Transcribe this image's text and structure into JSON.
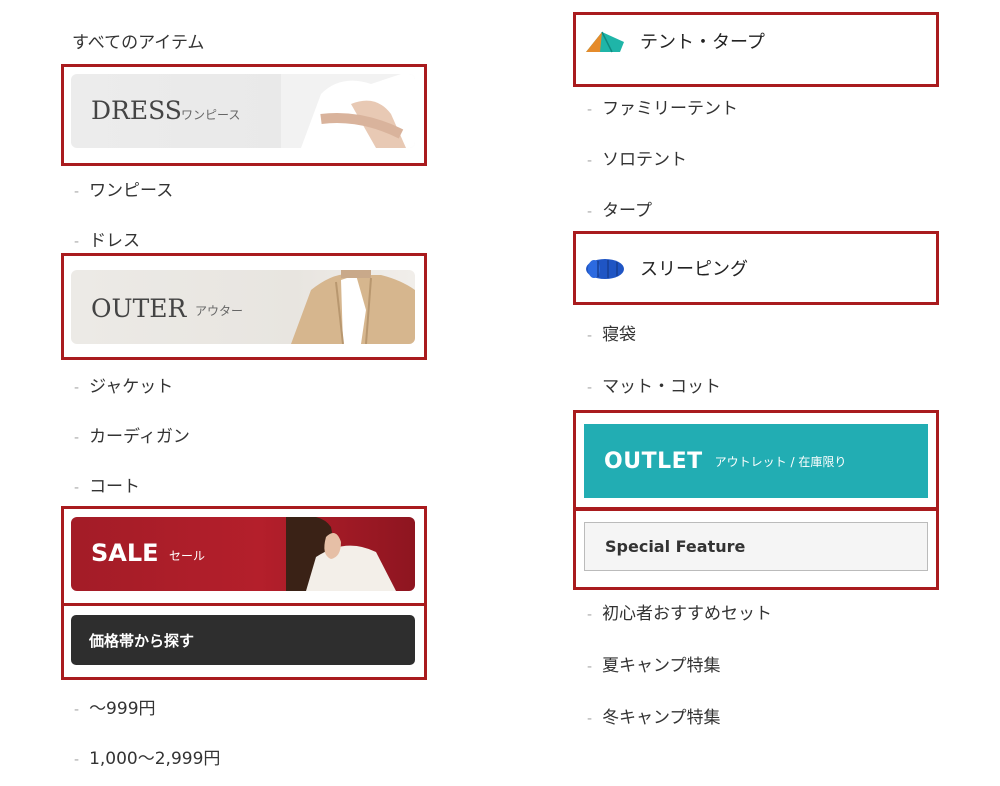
{
  "left": {
    "all_items": "すべてのアイテム",
    "dress": {
      "en": "DRESS",
      "jp": "ワンピース",
      "items": [
        "ワンピース",
        "ドレス"
      ]
    },
    "outer": {
      "en": "OUTER",
      "jp": "アウター",
      "items": [
        "ジャケット",
        "カーディガン",
        "コート"
      ]
    },
    "sale": {
      "en": "SALE",
      "jp": "セール"
    },
    "price": {
      "label": "価格帯から探す",
      "items": [
        "～999円",
        "1,000～2,999円"
      ]
    }
  },
  "right": {
    "tent": {
      "label": "テント・タープ",
      "items": [
        "ファミリーテント",
        "ソロテント",
        "タープ"
      ]
    },
    "sleeping": {
      "label": "スリーピング",
      "items": [
        "寝袋",
        "マット・コット"
      ]
    },
    "outlet": {
      "en": "OUTLET",
      "jp": "アウトレット / 在庫限り"
    },
    "special": {
      "label": "Special Feature",
      "items": [
        "初心者おすすめセット",
        "夏キャンプ特集",
        "冬キャンプ特集"
      ]
    }
  },
  "dash": "-",
  "colors": {
    "highlight": "#a91b1e",
    "sale": "#a01d26",
    "outlet": "#22adb3",
    "price": "#2e2e2e"
  }
}
